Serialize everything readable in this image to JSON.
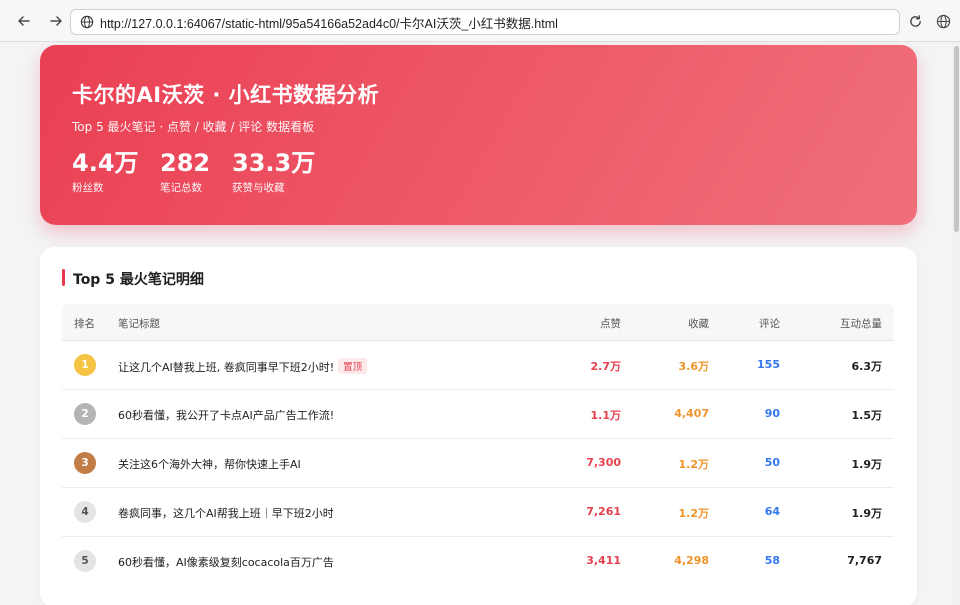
{
  "browser": {
    "url": "http://127.0.0.1:64067/static-html/95a54166a52ad4c0/卡尔AI沃茨_小红书数据.html"
  },
  "hero": {
    "title": "卡尔的AI沃茨 · 小红书数据分析",
    "subtitle": "Top 5 最火笔记 · 点赞 / 收藏 / 评论 数据看板",
    "stats": [
      {
        "value": "4.4万",
        "label": "粉丝数"
      },
      {
        "value": "282",
        "label": "笔记总数"
      },
      {
        "value": "33.3万",
        "label": "获赞与收藏"
      }
    ]
  },
  "table": {
    "title": "Top 5 最火笔记明细",
    "headers": {
      "rank": "排名",
      "title": "笔记标题",
      "likes": "点赞",
      "favorites": "收藏",
      "comments": "评论",
      "total": "互动总量"
    },
    "rows": [
      {
        "rank": "1",
        "title": "让这几个AI替我上班, 卷疯同事早下班2小时!",
        "badge": "置顶",
        "likes": "2.7万",
        "favorites": "3.6万",
        "comments": "155",
        "total": "6.3万"
      },
      {
        "rank": "2",
        "title": "60秒看懂，我公开了卡点AI产品广告工作流!",
        "badge": "",
        "likes": "1.1万",
        "favorites": "4,407",
        "comments": "90",
        "total": "1.5万"
      },
      {
        "rank": "3",
        "title": "关注这6个海外大神，帮你快速上手AI",
        "badge": "",
        "likes": "7,300",
        "favorites": "1.2万",
        "comments": "50",
        "total": "1.9万"
      },
      {
        "rank": "4",
        "title": "卷疯同事，这几个AI帮我上班｜早下班2小时",
        "badge": "",
        "likes": "7,261",
        "favorites": "1.2万",
        "comments": "64",
        "total": "1.9万"
      },
      {
        "rank": "5",
        "title": "60秒看懂，AI像素级复刻cocacola百万广告",
        "badge": "",
        "likes": "3,411",
        "favorites": "4,298",
        "comments": "58",
        "total": "7,767"
      }
    ]
  },
  "colors": {
    "accent": "#e8384b",
    "likes": "#e8404f",
    "favorites": "#f0932b",
    "comments": "#3478f0"
  }
}
